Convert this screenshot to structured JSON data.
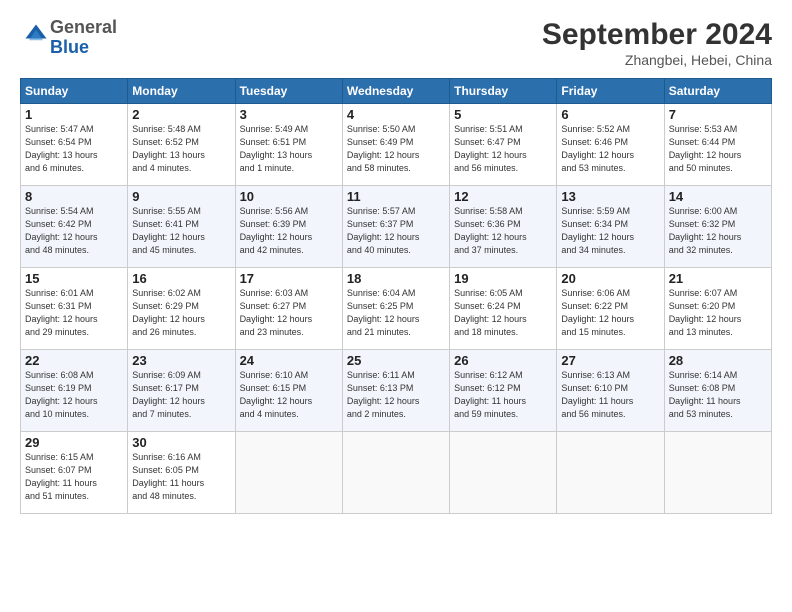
{
  "logo": {
    "general": "General",
    "blue": "Blue"
  },
  "header": {
    "month_year": "September 2024",
    "location": "Zhangbei, Hebei, China"
  },
  "weekdays": [
    "Sunday",
    "Monday",
    "Tuesday",
    "Wednesday",
    "Thursday",
    "Friday",
    "Saturday"
  ],
  "weeks": [
    [
      {
        "day": "1",
        "lines": [
          "Sunrise: 5:47 AM",
          "Sunset: 6:54 PM",
          "Daylight: 13 hours",
          "and 6 minutes."
        ]
      },
      {
        "day": "2",
        "lines": [
          "Sunrise: 5:48 AM",
          "Sunset: 6:52 PM",
          "Daylight: 13 hours",
          "and 4 minutes."
        ]
      },
      {
        "day": "3",
        "lines": [
          "Sunrise: 5:49 AM",
          "Sunset: 6:51 PM",
          "Daylight: 13 hours",
          "and 1 minute."
        ]
      },
      {
        "day": "4",
        "lines": [
          "Sunrise: 5:50 AM",
          "Sunset: 6:49 PM",
          "Daylight: 12 hours",
          "and 58 minutes."
        ]
      },
      {
        "day": "5",
        "lines": [
          "Sunrise: 5:51 AM",
          "Sunset: 6:47 PM",
          "Daylight: 12 hours",
          "and 56 minutes."
        ]
      },
      {
        "day": "6",
        "lines": [
          "Sunrise: 5:52 AM",
          "Sunset: 6:46 PM",
          "Daylight: 12 hours",
          "and 53 minutes."
        ]
      },
      {
        "day": "7",
        "lines": [
          "Sunrise: 5:53 AM",
          "Sunset: 6:44 PM",
          "Daylight: 12 hours",
          "and 50 minutes."
        ]
      }
    ],
    [
      {
        "day": "8",
        "lines": [
          "Sunrise: 5:54 AM",
          "Sunset: 6:42 PM",
          "Daylight: 12 hours",
          "and 48 minutes."
        ]
      },
      {
        "day": "9",
        "lines": [
          "Sunrise: 5:55 AM",
          "Sunset: 6:41 PM",
          "Daylight: 12 hours",
          "and 45 minutes."
        ]
      },
      {
        "day": "10",
        "lines": [
          "Sunrise: 5:56 AM",
          "Sunset: 6:39 PM",
          "Daylight: 12 hours",
          "and 42 minutes."
        ]
      },
      {
        "day": "11",
        "lines": [
          "Sunrise: 5:57 AM",
          "Sunset: 6:37 PM",
          "Daylight: 12 hours",
          "and 40 minutes."
        ]
      },
      {
        "day": "12",
        "lines": [
          "Sunrise: 5:58 AM",
          "Sunset: 6:36 PM",
          "Daylight: 12 hours",
          "and 37 minutes."
        ]
      },
      {
        "day": "13",
        "lines": [
          "Sunrise: 5:59 AM",
          "Sunset: 6:34 PM",
          "Daylight: 12 hours",
          "and 34 minutes."
        ]
      },
      {
        "day": "14",
        "lines": [
          "Sunrise: 6:00 AM",
          "Sunset: 6:32 PM",
          "Daylight: 12 hours",
          "and 32 minutes."
        ]
      }
    ],
    [
      {
        "day": "15",
        "lines": [
          "Sunrise: 6:01 AM",
          "Sunset: 6:31 PM",
          "Daylight: 12 hours",
          "and 29 minutes."
        ]
      },
      {
        "day": "16",
        "lines": [
          "Sunrise: 6:02 AM",
          "Sunset: 6:29 PM",
          "Daylight: 12 hours",
          "and 26 minutes."
        ]
      },
      {
        "day": "17",
        "lines": [
          "Sunrise: 6:03 AM",
          "Sunset: 6:27 PM",
          "Daylight: 12 hours",
          "and 23 minutes."
        ]
      },
      {
        "day": "18",
        "lines": [
          "Sunrise: 6:04 AM",
          "Sunset: 6:25 PM",
          "Daylight: 12 hours",
          "and 21 minutes."
        ]
      },
      {
        "day": "19",
        "lines": [
          "Sunrise: 6:05 AM",
          "Sunset: 6:24 PM",
          "Daylight: 12 hours",
          "and 18 minutes."
        ]
      },
      {
        "day": "20",
        "lines": [
          "Sunrise: 6:06 AM",
          "Sunset: 6:22 PM",
          "Daylight: 12 hours",
          "and 15 minutes."
        ]
      },
      {
        "day": "21",
        "lines": [
          "Sunrise: 6:07 AM",
          "Sunset: 6:20 PM",
          "Daylight: 12 hours",
          "and 13 minutes."
        ]
      }
    ],
    [
      {
        "day": "22",
        "lines": [
          "Sunrise: 6:08 AM",
          "Sunset: 6:19 PM",
          "Daylight: 12 hours",
          "and 10 minutes."
        ]
      },
      {
        "day": "23",
        "lines": [
          "Sunrise: 6:09 AM",
          "Sunset: 6:17 PM",
          "Daylight: 12 hours",
          "and 7 minutes."
        ]
      },
      {
        "day": "24",
        "lines": [
          "Sunrise: 6:10 AM",
          "Sunset: 6:15 PM",
          "Daylight: 12 hours",
          "and 4 minutes."
        ]
      },
      {
        "day": "25",
        "lines": [
          "Sunrise: 6:11 AM",
          "Sunset: 6:13 PM",
          "Daylight: 12 hours",
          "and 2 minutes."
        ]
      },
      {
        "day": "26",
        "lines": [
          "Sunrise: 6:12 AM",
          "Sunset: 6:12 PM",
          "Daylight: 11 hours",
          "and 59 minutes."
        ]
      },
      {
        "day": "27",
        "lines": [
          "Sunrise: 6:13 AM",
          "Sunset: 6:10 PM",
          "Daylight: 11 hours",
          "and 56 minutes."
        ]
      },
      {
        "day": "28",
        "lines": [
          "Sunrise: 6:14 AM",
          "Sunset: 6:08 PM",
          "Daylight: 11 hours",
          "and 53 minutes."
        ]
      }
    ],
    [
      {
        "day": "29",
        "lines": [
          "Sunrise: 6:15 AM",
          "Sunset: 6:07 PM",
          "Daylight: 11 hours",
          "and 51 minutes."
        ]
      },
      {
        "day": "30",
        "lines": [
          "Sunrise: 6:16 AM",
          "Sunset: 6:05 PM",
          "Daylight: 11 hours",
          "and 48 minutes."
        ]
      },
      null,
      null,
      null,
      null,
      null
    ]
  ]
}
